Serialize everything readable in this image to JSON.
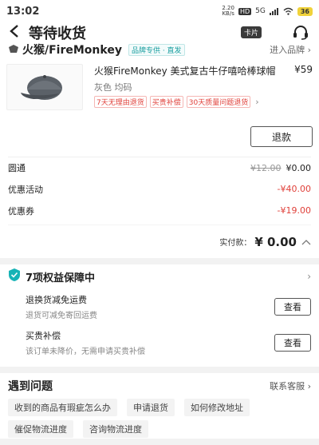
{
  "status_bar": {
    "time": "13:02",
    "net_speed_top": "2.20",
    "net_speed_bottom": "KB/s",
    "hd": "HD",
    "signal": "5G",
    "battery": "36"
  },
  "header": {
    "title": "等待收货",
    "card_label": "卡片"
  },
  "shop": {
    "name": "火猴/FireMonkey",
    "brand_tag": "品牌专供 · 直发",
    "enter": "进入品牌 ›"
  },
  "product": {
    "title": "火猴FireMonkey 美式复古牛仔嘻哈棒球帽",
    "price": "¥59",
    "spec": "灰色 均码",
    "tags": [
      "7天无理由退货",
      "买贵补偿",
      "30天质量问题退货"
    ],
    "refund_label": "退款"
  },
  "fees": [
    {
      "label": "圆通",
      "original": "¥12.00",
      "value": "¥0.00",
      "value_color": "#222222"
    },
    {
      "label": "优惠活动",
      "original": "",
      "value": "-¥40.00",
      "value_color": "#e0403a"
    },
    {
      "label": "优惠券",
      "original": "",
      "value": "-¥19.00",
      "value_color": "#e0403a"
    }
  ],
  "paid": {
    "label": "实付款：",
    "amount": "¥ 0.00"
  },
  "rights": {
    "title": "7项权益保障中",
    "items": [
      {
        "name": "退换货减免运费",
        "desc": "退货可减免寄回运费",
        "button": "查看"
      },
      {
        "name": "买贵补偿",
        "desc": "该订单未降价，无需申请买贵补偿",
        "button": "查看"
      }
    ]
  },
  "problems": {
    "title": "遇到问题",
    "service": "联系客服 ›",
    "chips": [
      "收到的商品有瑕疵怎么办",
      "申请退货",
      "如何修改地址",
      "催促物流进度",
      "咨询物流进度"
    ]
  },
  "colors": {
    "accent_red": "#e0403a",
    "brand_teal": "#1a9fa0",
    "shield_teal": "#17b3b6"
  }
}
